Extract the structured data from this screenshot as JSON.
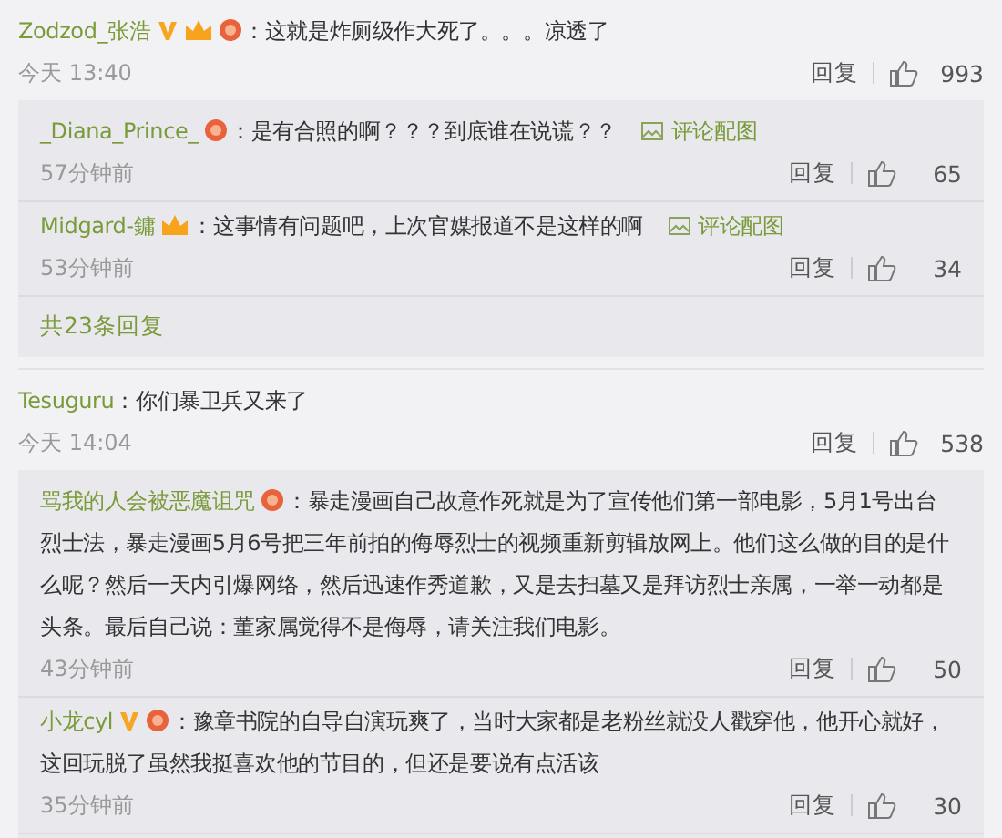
{
  "comments": [
    {
      "user": "Zodzod_张浩",
      "verified": true,
      "vip": true,
      "medal": true,
      "text": "：这就是炸厕级作大死了。。。凉透了",
      "time": "今天 13:40",
      "reply_label": "回复",
      "likes": "993",
      "replies": [
        {
          "user": "_Diana_Prince_",
          "verified": false,
          "vip": false,
          "medal": true,
          "text": "：是有合照的啊？？？到底谁在说谎？？",
          "image_link": "评论配图",
          "time": "57分钟前",
          "reply_label": "回复",
          "likes": "65"
        },
        {
          "user": "Midgard-鏞",
          "verified": false,
          "vip": true,
          "medal": false,
          "text": "：这事情有问题吧，上次官媒报道不是这样的啊",
          "image_link": "评论配图",
          "time": "53分钟前",
          "reply_label": "回复",
          "likes": "34"
        }
      ],
      "more": "共23条回复"
    },
    {
      "user": "Tesuguru",
      "verified": false,
      "vip": false,
      "medal": false,
      "text": "：你们暴卫兵又来了",
      "time": "今天 14:04",
      "reply_label": "回复",
      "likes": "538",
      "replies": [
        {
          "user": "骂我的人会被恶魔诅咒",
          "verified": false,
          "vip": false,
          "medal": true,
          "text": "：暴走漫画自己故意作死就是为了宣传他们第一部电影，5月1号出台烈士法，暴走漫画5月6号把三年前拍的侮辱烈士的视频重新剪辑放网上。他们这么做的目的是什么呢？然后一天内引爆网络，然后迅速作秀道歉，又是去扫墓又是拜访烈士亲属，一举一动都是头条。最后自己说：董家属觉得不是侮辱，请关注我们电影。",
          "time": "43分钟前",
          "reply_label": "回复",
          "likes": "50"
        },
        {
          "user": "小龙cyl",
          "verified": true,
          "vip": false,
          "medal": true,
          "text": "：豫章书院的自导自演玩爽了，当时大家都是老粉丝就没人戳穿他，他开心就好，这回玩脱了虽然我挺喜欢他的节目的，但还是要说有点活该",
          "time": "35分钟前",
          "reply_label": "回复",
          "likes": "30"
        }
      ]
    }
  ]
}
